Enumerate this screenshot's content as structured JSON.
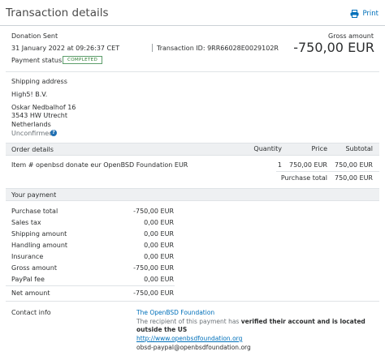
{
  "header": {
    "title": "Transaction details",
    "print_label": "Print"
  },
  "summary": {
    "status_line": "Donation Sent",
    "date": "31 January 2022 at 09:26:37 CET",
    "transaction_id": "Transaction ID: 9RR66028E0029102R",
    "gross_label": "Gross amount",
    "gross_value": "-750,00 EUR",
    "payment_status_label": "Payment status:",
    "payment_status": "COMPLETED"
  },
  "shipping": {
    "heading": "Shipping address",
    "company": "High5! B.V.",
    "name": "Oskar Nedbalhof 16",
    "street": "3543 HW Utrecht",
    "country": "Netherlands",
    "status": "Unconfirmed"
  },
  "order": {
    "headers": {
      "details": "Order details",
      "quantity": "Quantity",
      "price": "Price",
      "subtotal": "Subtotal"
    },
    "item": {
      "description": "Item # openbsd donate eur  OpenBSD Foundation EUR",
      "quantity": "1",
      "price": "750,00 EUR",
      "subtotal": "750,00 EUR"
    },
    "purchase_total_label": "Purchase total",
    "purchase_total_value": "750,00 EUR"
  },
  "payment": {
    "heading": "Your payment",
    "rows": [
      {
        "label": "Purchase total",
        "value": "-750,00 EUR"
      },
      {
        "label": "Sales tax",
        "value": "0,00 EUR"
      },
      {
        "label": "Shipping amount",
        "value": "0,00 EUR"
      },
      {
        "label": "Handling amount",
        "value": "0,00 EUR"
      },
      {
        "label": "Insurance",
        "value": "0,00 EUR"
      },
      {
        "label": "Gross amount",
        "value": "-750,00 EUR"
      },
      {
        "label": "PayPal fee",
        "value": "0,00 EUR"
      }
    ],
    "net_label": "Net amount",
    "net_value": "-750,00 EUR"
  },
  "contact": {
    "label": "Contact info",
    "org": "The OpenBSD Foundation",
    "note_prefix": "The recipient of this payment has ",
    "note_bold": "verified their account and is located outside the US",
    "website": "http://www.openbsdfoundation.org",
    "email": "obsd-paypal@openbsdfoundation.org"
  },
  "colors": {
    "link": "#0070ba",
    "status_green": "#2e7d32",
    "band": "#eef0f2"
  },
  "icons": {
    "print": "printer-icon",
    "help": "help-circle-icon"
  }
}
